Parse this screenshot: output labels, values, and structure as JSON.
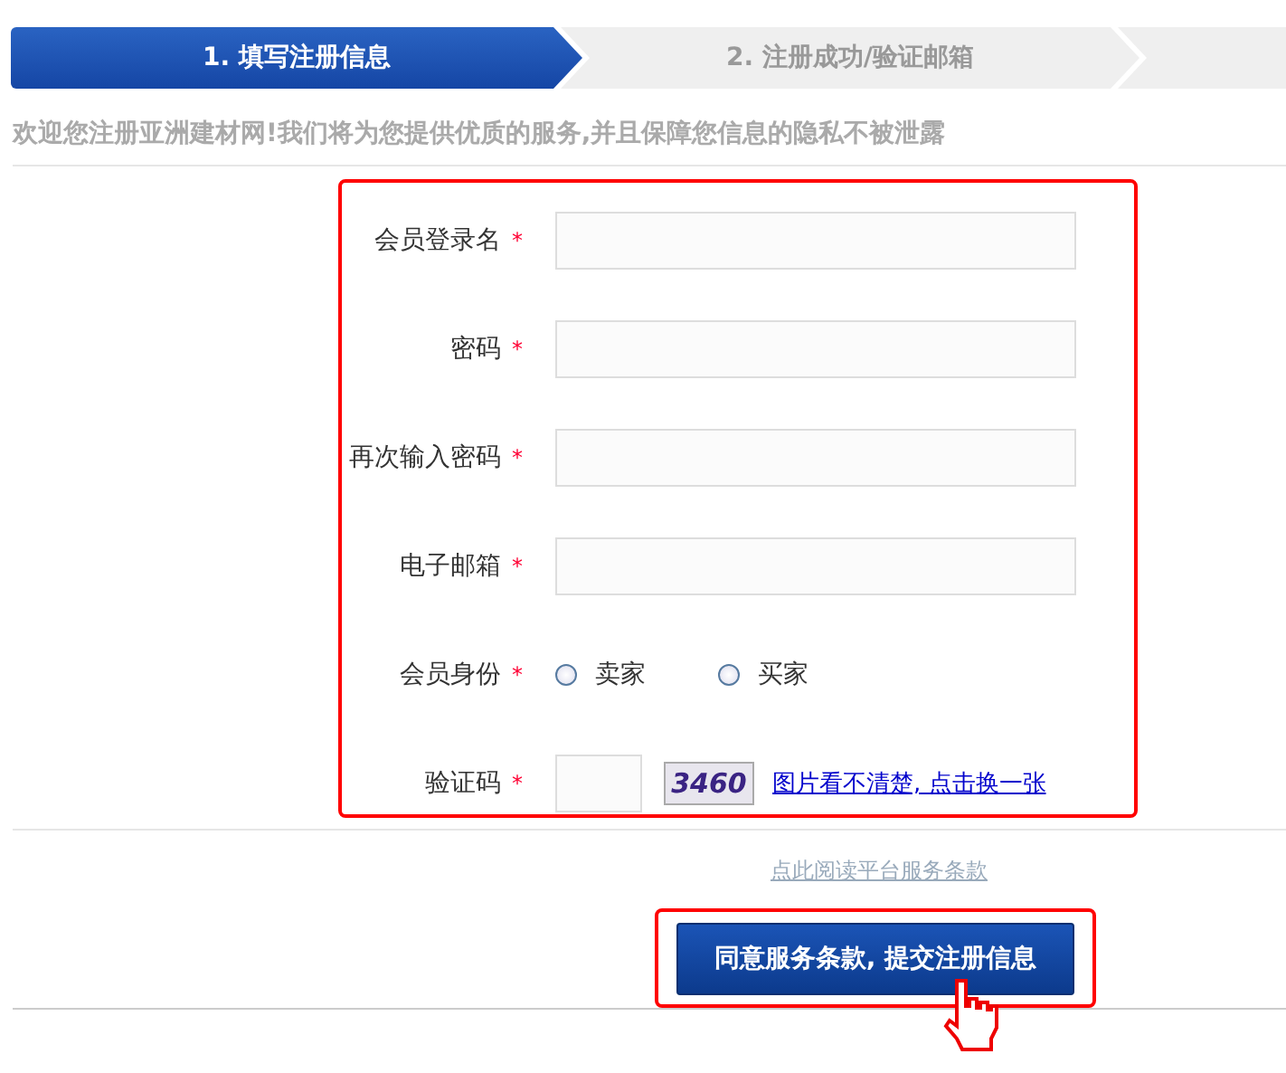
{
  "steps": [
    {
      "label": "1. 填写注册信息",
      "selected": true
    },
    {
      "label": "2. 注册成功/验证邮箱",
      "selected": false
    },
    {
      "selected": false
    }
  ],
  "intro": "欢迎您注册亚洲建材网!我们将为您提供优质的服务,并且保障您信息的隐私不被泄露",
  "form": {
    "fields": [
      {
        "kind": "text",
        "label": "会员登录名",
        "required": true
      },
      {
        "kind": "text",
        "label": "密码",
        "required": true
      },
      {
        "kind": "text",
        "label": "再次输入密码",
        "required": true
      },
      {
        "kind": "text",
        "label": "电子邮箱",
        "required": true
      },
      {
        "kind": "radio",
        "label": "会员身份",
        "required": true,
        "options": [
          {
            "label": "卖家",
            "selected": false
          },
          {
            "label": "买家",
            "selected": false
          }
        ]
      },
      {
        "kind": "captcha",
        "label": "验证码",
        "required": true,
        "captcha_text": "3460",
        "refresh_link": "图片看不清楚, 点击换一张"
      }
    ],
    "required_mark": "*"
  },
  "terms_link": "点此阅读平台服务条款",
  "submit_button": "同意服务条款, 提交注册信息"
}
